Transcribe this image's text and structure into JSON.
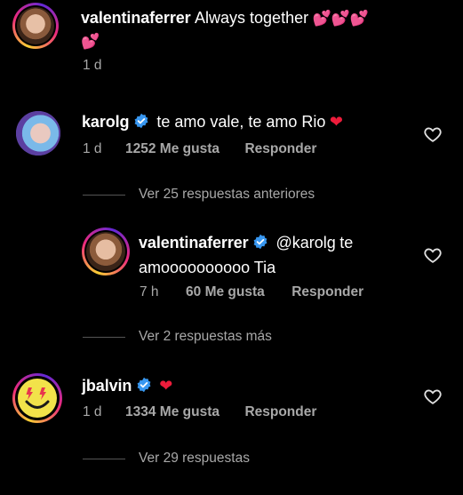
{
  "comments": [
    {
      "username": "valentinaferrer",
      "text": "Always together",
      "emoji": "💕💕💕💕",
      "time": "1 d"
    },
    {
      "username": "karolg",
      "verified": true,
      "text": "te amo vale, te amo Rio",
      "emoji": "❤️",
      "time": "1 d",
      "likes": "1252 Me gusta",
      "reply_label": "Responder",
      "view_replies": "Ver 25 respuestas anteriores"
    },
    {
      "username": "valentinaferrer",
      "verified": true,
      "mention": "@karolg",
      "text_line1": "te",
      "text_line2": "amoooooooooo Tia",
      "time": "7 h",
      "likes": "60 Me gusta",
      "reply_label": "Responder",
      "view_replies": "Ver 2 respuestas más"
    },
    {
      "username": "jbalvin",
      "verified": true,
      "emoji": "❤️",
      "time": "1 d",
      "likes": "1334 Me gusta",
      "reply_label": "Responder",
      "view_replies": "Ver 29 respuestas"
    }
  ],
  "colors": {
    "background": "#000000",
    "secondary_text": "#a8a8a8",
    "verified_blue": "#3897f0",
    "heart_red": "#ed1c3b"
  },
  "icons": {
    "verified": "verified-badge-icon",
    "like": "heart-outline-icon"
  }
}
